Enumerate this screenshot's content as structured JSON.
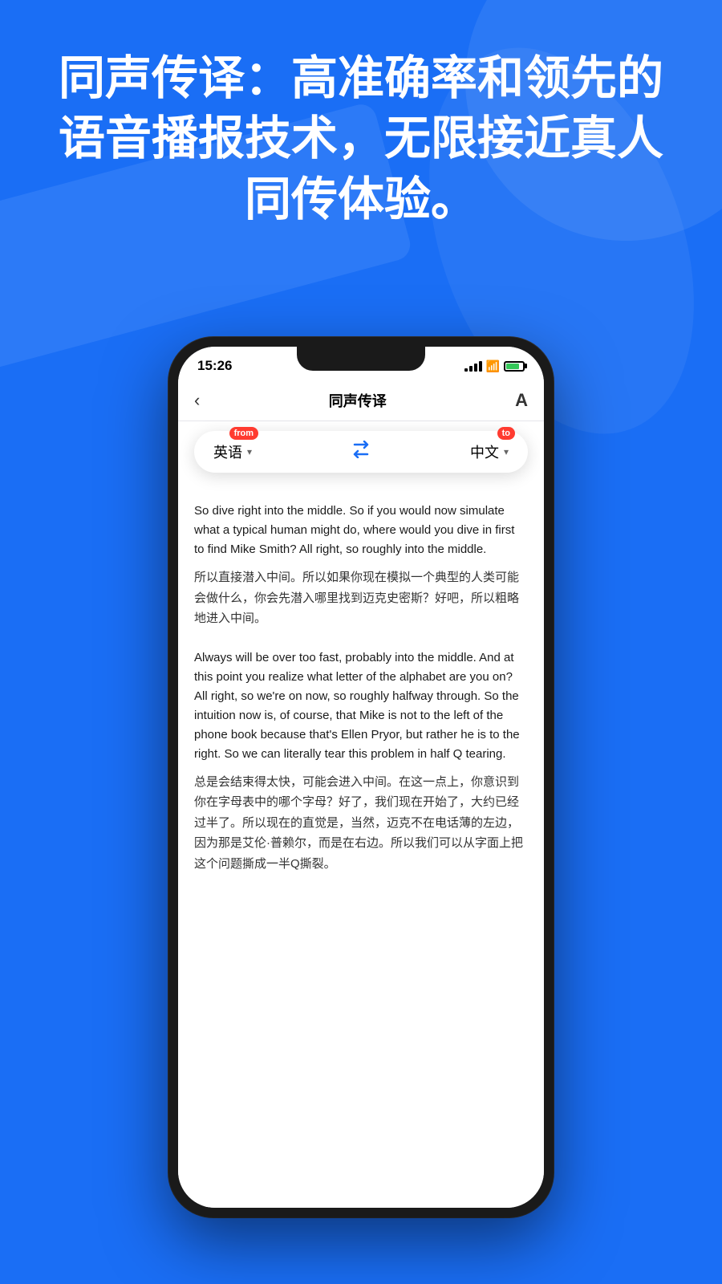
{
  "background": {
    "color": "#1a6ef5"
  },
  "headline": {
    "text": "同声传译：高准确率和领先的语音播报技术，无限接近真人同传体验。"
  },
  "phone": {
    "status_bar": {
      "time": "15:26",
      "signal_label": "signal",
      "wifi_label": "wifi",
      "battery_label": "battery"
    },
    "nav": {
      "back_label": "‹",
      "title": "同声传译",
      "font_label": "A"
    },
    "lang_selector": {
      "from_lang": "英语",
      "from_badge": "from",
      "to_lang": "中文",
      "to_badge": "to",
      "swap_label": "⇄"
    },
    "content": {
      "block1": {
        "original": "So dive right into the middle. So if you would now simulate what a typical human might do, where would you dive in first to find Mike Smith? All right, so roughly into the middle.",
        "translated": "所以直接潜入中间。所以如果你现在模拟一个典型的人类可能会做什么，你会先潜入哪里找到迈克史密斯？好吧，所以粗略地进入中间。"
      },
      "block2": {
        "original": "Always will be over too fast, probably into the middle. And at this point you realize what letter of the alphabet are you on? All right, so we're on now, so roughly halfway through. So the intuition now is, of course, that Mike is not to the left of the phone book because that's Ellen Pryor, but rather he is to the right. So we can literally tear this problem in half Q tearing.",
        "translated": "总是会结束得太快，可能会进入中间。在这一点上，你意识到你在字母表中的哪个字母？好了，我们现在开始了，大约已经过半了。所以现在的直觉是，当然，迈克不在电话薄的左边，因为那是艾伦·普赖尔，而是在右边。所以我们可以从字面上把这个问题撕成一半Q撕裂。"
      }
    }
  }
}
